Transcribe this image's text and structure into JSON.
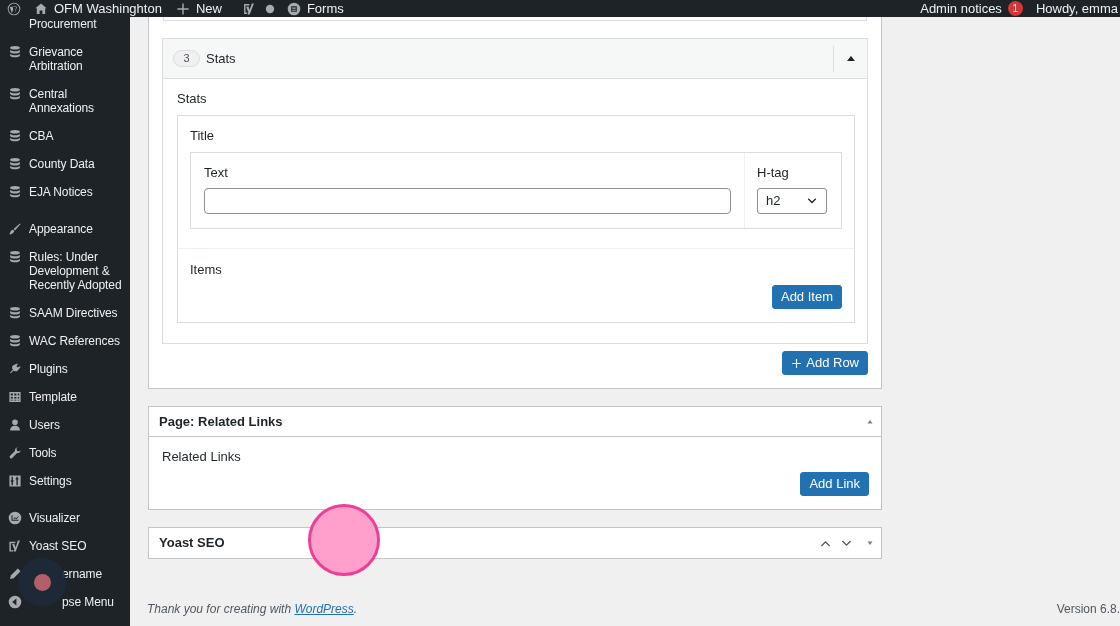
{
  "admin_bar": {
    "site": "OFM Washinghton",
    "new": "New",
    "forms": "Forms",
    "notices": "Admin notices",
    "notice_count": "1",
    "greeting": "Howdy, emma"
  },
  "sidebar": {
    "groups": [
      {
        "items": [
          {
            "label": "Procurement",
            "kind": "none"
          },
          {
            "label": "Grievance Arbitration",
            "kind": "database"
          },
          {
            "label": "Central Annexations",
            "kind": "database"
          },
          {
            "label": "CBA",
            "kind": "database"
          },
          {
            "label": "County Data",
            "kind": "database"
          },
          {
            "label": "EJA Notices",
            "kind": "database"
          }
        ]
      },
      {
        "items": [
          {
            "label": "Appearance",
            "kind": "brush"
          },
          {
            "label": "Rules: Under Development & Recently Adopted",
            "kind": "database"
          },
          {
            "label": "SAAM Directives",
            "kind": "database"
          },
          {
            "label": "WAC References",
            "kind": "database"
          },
          {
            "label": "Plugins",
            "kind": "plug"
          },
          {
            "label": "Template",
            "kind": "grid"
          },
          {
            "label": "Users",
            "kind": "user"
          },
          {
            "label": "Tools",
            "kind": "wrench"
          },
          {
            "label": "Settings",
            "kind": "sliders"
          }
        ]
      },
      {
        "items": [
          {
            "label": "Visualizer",
            "kind": "chart"
          },
          {
            "label": "Yoast SEO",
            "kind": "yoast"
          }
        ]
      },
      {
        "partly_covered": true,
        "items": [
          {
            "label": "ername",
            "kind": "pencil"
          },
          {
            "label": "pse Menu",
            "kind": "collapse"
          }
        ]
      }
    ]
  },
  "flexible_content": {
    "row": {
      "number": "3",
      "title": "Stats",
      "expanded": true,
      "section_label": "Stats",
      "group_label": "Title",
      "text_label": "Text",
      "htag_label": "H-tag",
      "htag_value": "h2",
      "items_label": "Items",
      "add_item": "Add Item"
    },
    "add_row": "Add Row"
  },
  "related_links": {
    "title": "Page: Related Links",
    "label": "Related Links",
    "add_link": "Add Link"
  },
  "yoast": {
    "title": "Yoast SEO"
  },
  "footer": {
    "thanks": "Thank you for creating with",
    "link": "WordPress",
    "period": ".",
    "version": "Version 6.8."
  },
  "overlays": {
    "tap_indicator": true,
    "pointer_indicator": true
  }
}
